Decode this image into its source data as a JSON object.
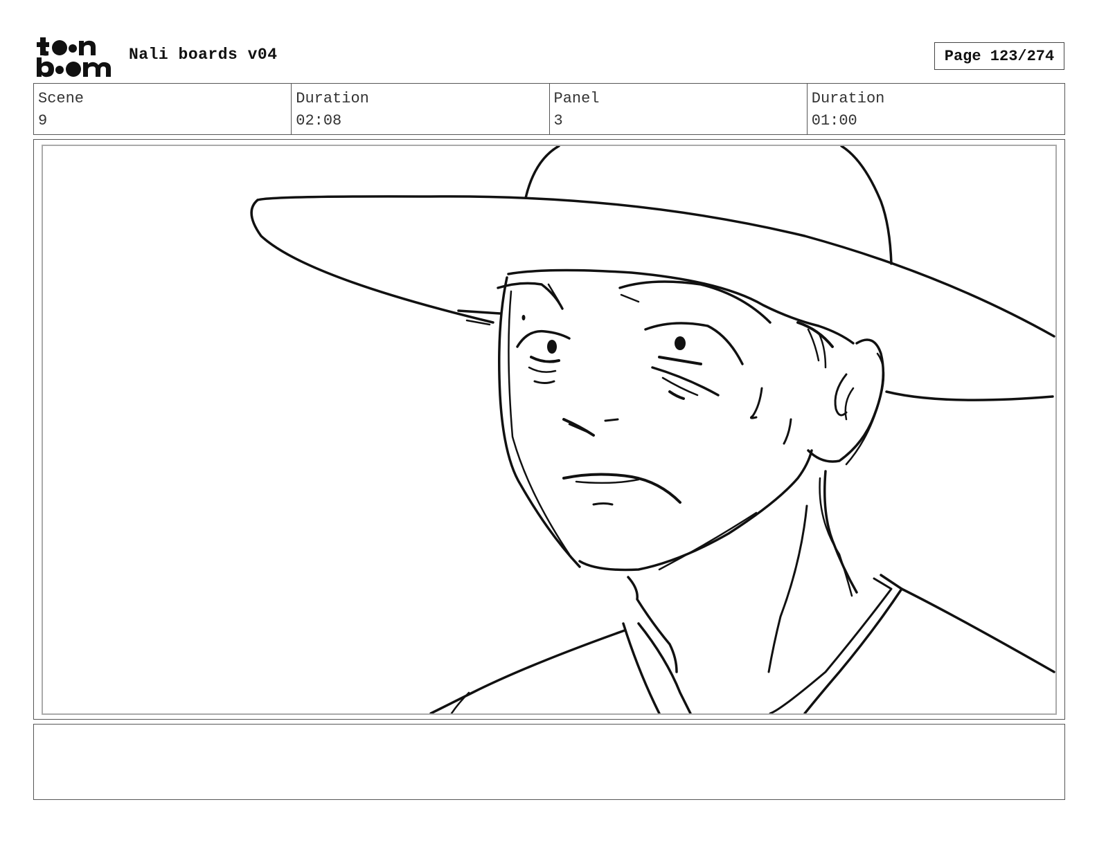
{
  "header": {
    "logo_alt": "toon boom",
    "title": "Nali boards v04",
    "page_label": "Page 123/274"
  },
  "info": [
    {
      "label": "Scene",
      "value": "9"
    },
    {
      "label": "Duration",
      "value": "02:08"
    },
    {
      "label": "Panel",
      "value": "3"
    },
    {
      "label": "Duration",
      "value": "01:00"
    }
  ],
  "panel": {
    "drawing": "storyboard sketch"
  },
  "notes": {
    "text": ""
  }
}
